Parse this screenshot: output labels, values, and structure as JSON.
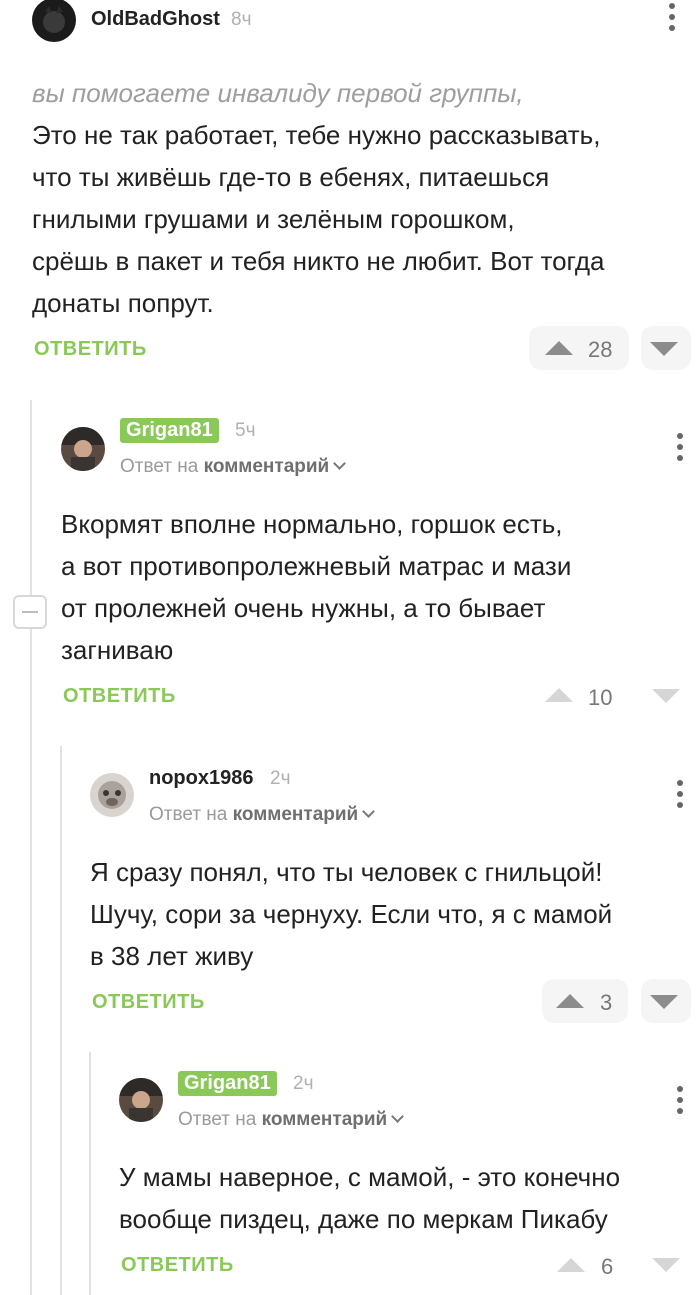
{
  "reply_prefix": "Ответ на",
  "reply_target": "комментарий",
  "comments": [
    {
      "author": "OldBadGhost",
      "time": "8ч",
      "quote": "вы помогаете инвалиду первой группы,",
      "text": "Это не так работает, тебе нужно рассказывать,\nчто ты живёшь где-то в ебенях, питаешься\nгнилыми грушами и зелёным горошком,\nсрёшь в пакет и тебя никто не любит. Вот тогда\nдонаты попрут.",
      "reply_label": "ОТВЕТИТЬ",
      "rating": "28"
    },
    {
      "author": "Grigan81",
      "time": "5ч",
      "text": "Вкормят вполне нормально, горшок есть,\nа вот противопролежневый матрас и мази\nот пролежней очень нужны, а то бывает\nзагниваю",
      "reply_label": "ОТВЕТИТЬ",
      "rating": "10"
    },
    {
      "author": "nopox1986",
      "time": "2ч",
      "text": "Я сразу понял, что ты человек с гнильцой!\nШучу, сори за чернуху. Если что, я с мамой\nв 38 лет живу",
      "reply_label": "ОТВЕТИТЬ",
      "rating": "3"
    },
    {
      "author": "Grigan81",
      "time": "2ч",
      "text": "У мамы наверное, с мамой, - это конечно\nвообще пиздец, даже по меркам Пикабу",
      "reply_label": "ОТВЕТИТЬ",
      "rating": "6"
    }
  ]
}
